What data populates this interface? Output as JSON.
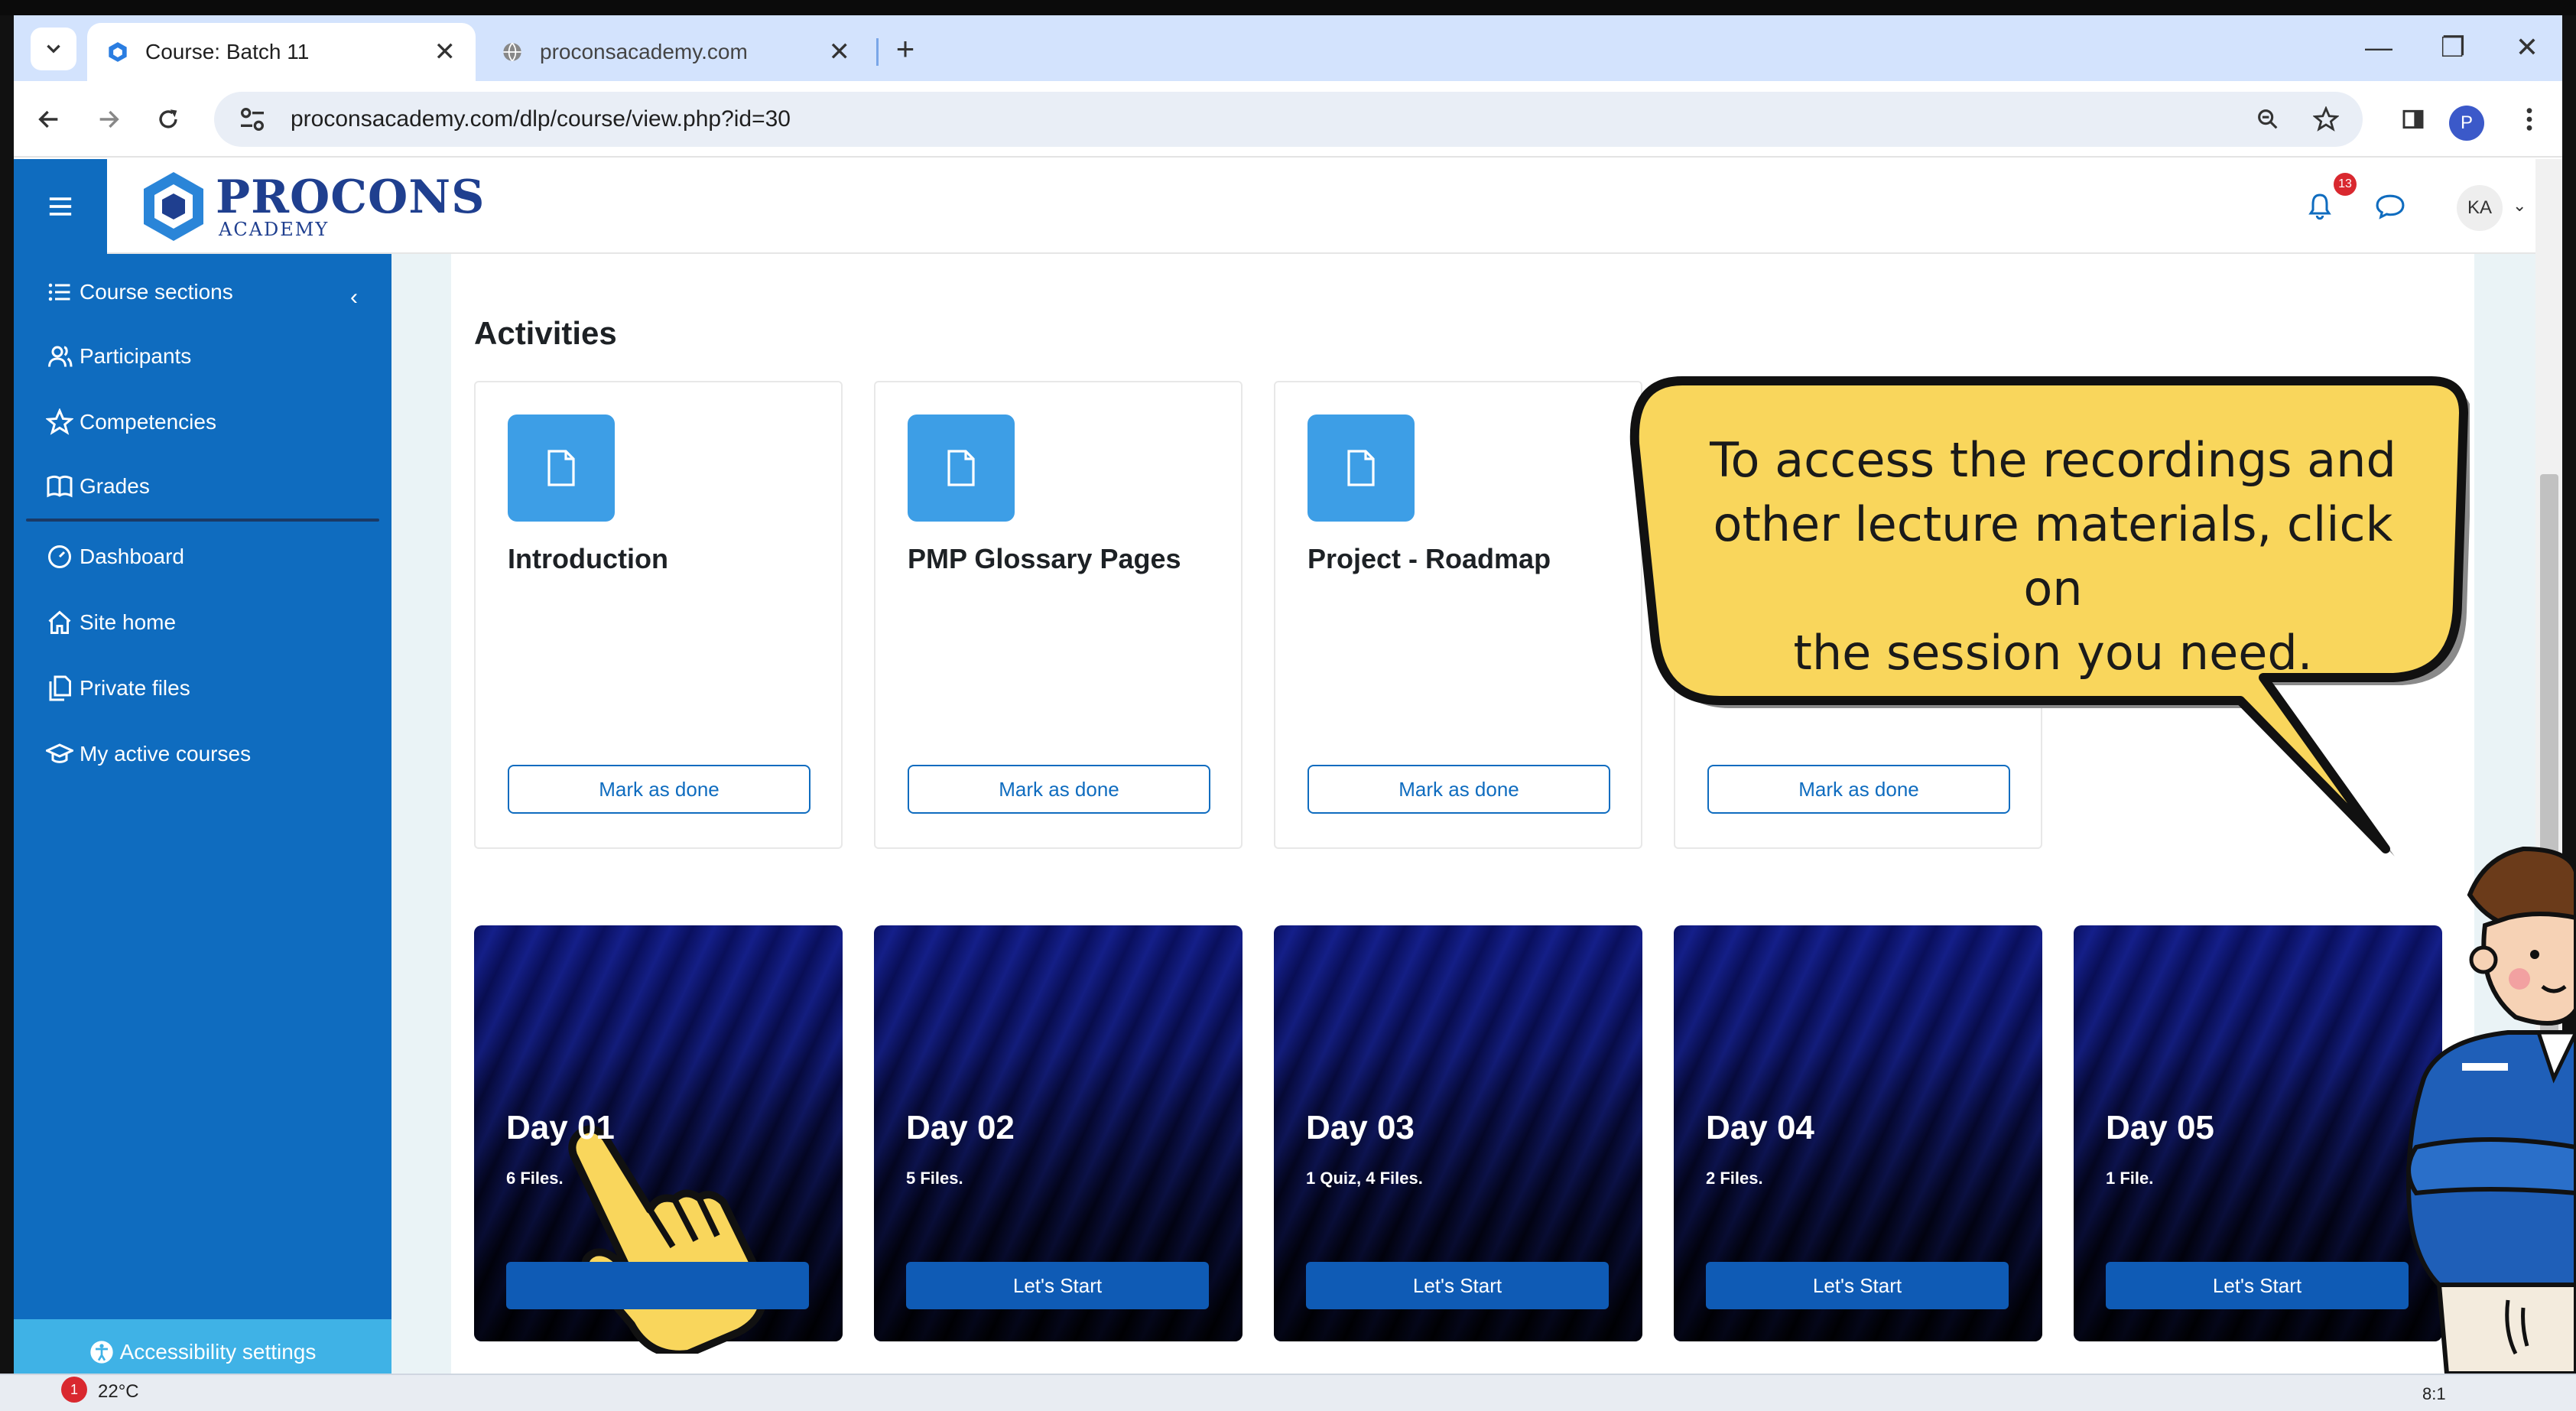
{
  "browser": {
    "tabs": [
      {
        "title": "Course: Batch 11",
        "active": true
      },
      {
        "title": "proconsacademy.com",
        "active": false
      }
    ],
    "url": "proconsacademy.com/dlp/course/view.php?id=30",
    "profile_initial": "P"
  },
  "site": {
    "logo_main": "PROCONS",
    "logo_sub": "ACADEMY",
    "notification_count": "13",
    "user_initials": "KA"
  },
  "sidebar": {
    "items": [
      {
        "label": "Course sections",
        "icon": "list-icon"
      },
      {
        "label": "Participants",
        "icon": "users-icon"
      },
      {
        "label": "Competencies",
        "icon": "star-icon"
      },
      {
        "label": "Grades",
        "icon": "book-icon"
      },
      {
        "label": "Dashboard",
        "icon": "gauge-icon"
      },
      {
        "label": "Site home",
        "icon": "home-icon"
      },
      {
        "label": "Private files",
        "icon": "files-icon"
      },
      {
        "label": "My active courses",
        "icon": "graduation-cap-icon"
      }
    ],
    "accessibility_label": "Accessibility settings"
  },
  "main": {
    "activities_title": "Activities",
    "activities": [
      {
        "name": "Introduction",
        "button": "Mark as done"
      },
      {
        "name": "PMP Glossary Pages",
        "button": "Mark as done"
      },
      {
        "name": "Project - Roadmap",
        "button": "Mark as done"
      },
      {
        "name": "",
        "button": "Mark as done"
      }
    ],
    "days": [
      {
        "title": "Day 01",
        "files": "6 Files.",
        "button": ""
      },
      {
        "title": "Day 02",
        "files": "5 Files.",
        "button": "Let's Start"
      },
      {
        "title": "Day 03",
        "files": "1 Quiz, 4 Files.",
        "button": "Let's Start"
      },
      {
        "title": "Day 04",
        "files": "2 Files.",
        "button": "Let's Start"
      },
      {
        "title": "Day 05",
        "files": "1 File.",
        "button": "Let's Start"
      }
    ]
  },
  "overlay": {
    "bubble_lines": [
      "To access the recordings and",
      "other lecture materials, click on",
      "the session you need."
    ]
  },
  "taskbar": {
    "weather": "22°C",
    "weather_badge": "1",
    "clock": "8:1"
  },
  "colors": {
    "brand_blue": "#0f6cbf",
    "accessibility_bar": "#3fb2e6",
    "bubble_fill": "#f9d65c",
    "tab_strip": "#d3e3fd"
  }
}
